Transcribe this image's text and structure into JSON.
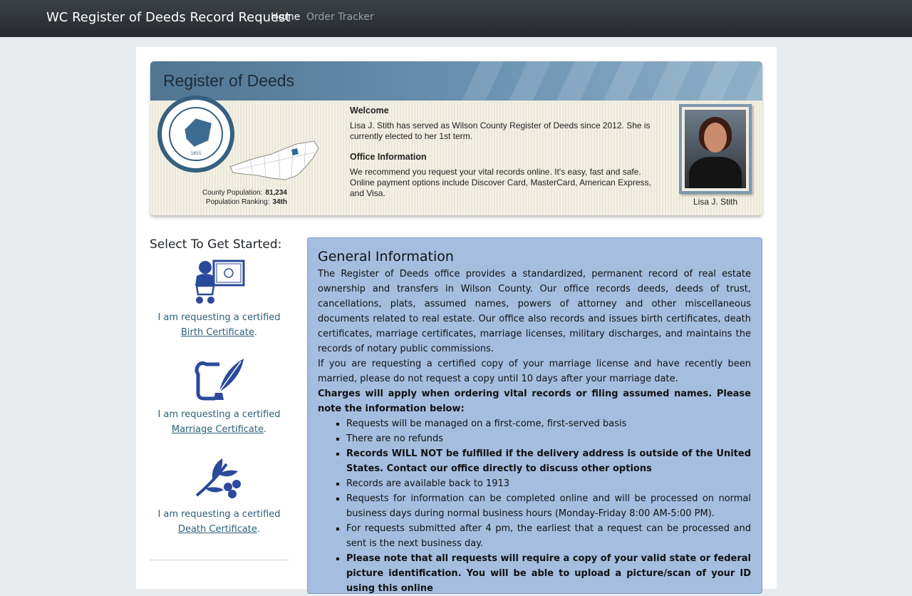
{
  "navbar": {
    "brand": "WC Register of Deeds Record Request",
    "links": [
      {
        "label": "Home"
      },
      {
        "label": "Order Tracker"
      }
    ]
  },
  "banner": {
    "title": "Register of Deeds",
    "seal": {
      "year": "1855"
    },
    "stats": {
      "population_label": "County Population:",
      "population_value": "81,234",
      "ranking_label": "Population Ranking:",
      "ranking_value": "34th"
    },
    "welcome": {
      "heading": "Welcome",
      "text": "Lisa J. Stith has served as Wilson County Register of Deeds since 2012.  She is currently elected to her 1st term."
    },
    "office": {
      "heading": "Office Information",
      "text": "We recommend you request your vital records online.  It's easy, fast and safe.  Online payment options include Discover Card, MasterCard, American Express, and Visa."
    },
    "portrait_caption": "Lisa J. Stith"
  },
  "sidebar": {
    "heading": "Select To Get Started:",
    "options": [
      {
        "prefix": "I am requesting a certified ",
        "link": "Birth Certificate",
        "suffix": "."
      },
      {
        "prefix": "I am requesting a certified ",
        "link": "Marriage Certificate",
        "suffix": "."
      },
      {
        "prefix": "I am requesting a certified ",
        "link": "Death Certificate",
        "suffix": "."
      }
    ]
  },
  "general": {
    "title": "General Information",
    "para1": "The Register of Deeds office provides a standardized, permanent record of real estate ownership and transfers in Wilson County. Our office records deeds, deeds of trust, cancellations, plats, assumed names, powers of attorney and other miscellaneous documents related to real estate. Our office also records and issues birth certificates, death certificates, marriage certificates, marriage licenses, military discharges, and maintains the records of notary public commissions.",
    "para2": "If you are requesting a certified copy of your marriage license and have recently been married, please do not request a copy until 10 days after your marriage date.",
    "charges": "Charges will apply when ordering vital records or filing assumed names. Please note the information below:",
    "items": [
      "Requests will be managed on a first-come, first-served basis",
      "There are no refunds",
      "Records WILL NOT be fulfilled if the delivery address is outside of the United States.  Contact our office directly to discuss other options",
      "Records are available back to 1913",
      "Requests for information can be completed online and will be processed on normal business days during normal business hours (Monday-Friday 8:00 AM-5:00 PM).",
      "For requests submitted after 4 pm, the earliest that a request can be processed and sent is the next business day.",
      "Please note that all requests will require a copy of your valid state or federal picture identification. You will be able to upload a picture/scan of your ID using this online"
    ]
  },
  "colors": {
    "navbar": "#2f3337",
    "panel_bg": "#a5bedf",
    "link": "#2c5f7a",
    "icon_blue": "#2b4a9b"
  }
}
